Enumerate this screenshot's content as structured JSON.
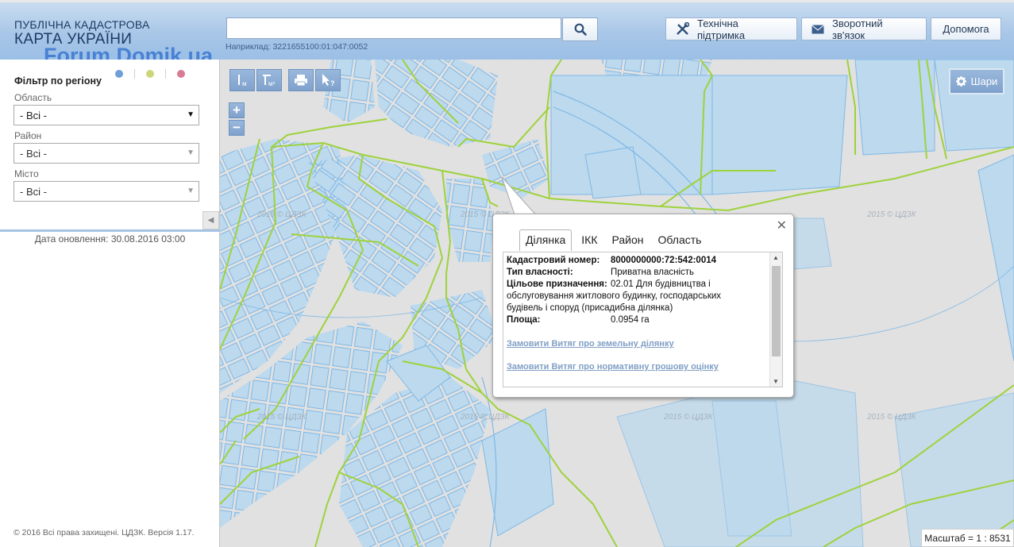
{
  "header": {
    "brand_line1": "ПУБЛІЧНА КАДАСТРОВА",
    "brand_line2": "КАРТА УКРАЇНИ",
    "watermark": "Forum.Domik.ua",
    "search": {
      "value": "",
      "hint": "Наприклад: 3221655100:01:047:0052"
    },
    "buttons": {
      "support": "Технічна підтримка",
      "feedback": "Зворотний зв'язок",
      "help": "Допомога"
    }
  },
  "sidebar": {
    "filter_title": "Фільтр по регіону",
    "dots": [
      "#6f9fd8",
      "#cdd77a",
      "#d97a93"
    ],
    "region": {
      "label": "Область",
      "value": "- Всі -"
    },
    "district": {
      "label": "Район",
      "value": "- Всі -"
    },
    "city": {
      "label": "Місто",
      "value": "- Всі -"
    },
    "update_date": "Дата оновлення: 30.08.2016 03:00",
    "copyright": "© 2016 Всі права захищені. ЦДЗК. Версія 1.17."
  },
  "map": {
    "layers_label": "Шари",
    "scale": "Масштаб = 1 : 8531",
    "watermark_text": "2015 © ЦДЗК",
    "colors": {
      "parcel_fill": "#bcd9ee",
      "parcel_stroke": "#7fb8e6",
      "boundary": "#9ed23c",
      "background": "#e1e1e1"
    }
  },
  "popup": {
    "tabs": [
      "Ділянка",
      "ІКК",
      "Район",
      "Область"
    ],
    "active_tab": "Ділянка",
    "fields": {
      "cadastral_label": "Кадастровий номер:",
      "cadastral_value": "8000000000:72:542:0014",
      "ownership_label": "Тип власності:",
      "ownership_value": "Приватна власність",
      "purpose_label": "Цільове призначення:",
      "purpose_value_line1": "02.01 Для будівництва і",
      "purpose_value_rest": "обслуговування житлового будинку, господарських будівель і споруд (присадибна ділянка)",
      "area_label": "Площа:",
      "area_value": "0.0954 га"
    },
    "links": {
      "extract_land": "Замовити Витяг про земельну ділянку",
      "extract_valuation": "Замовити Витяг про нормативну грошову оцінку"
    }
  }
}
